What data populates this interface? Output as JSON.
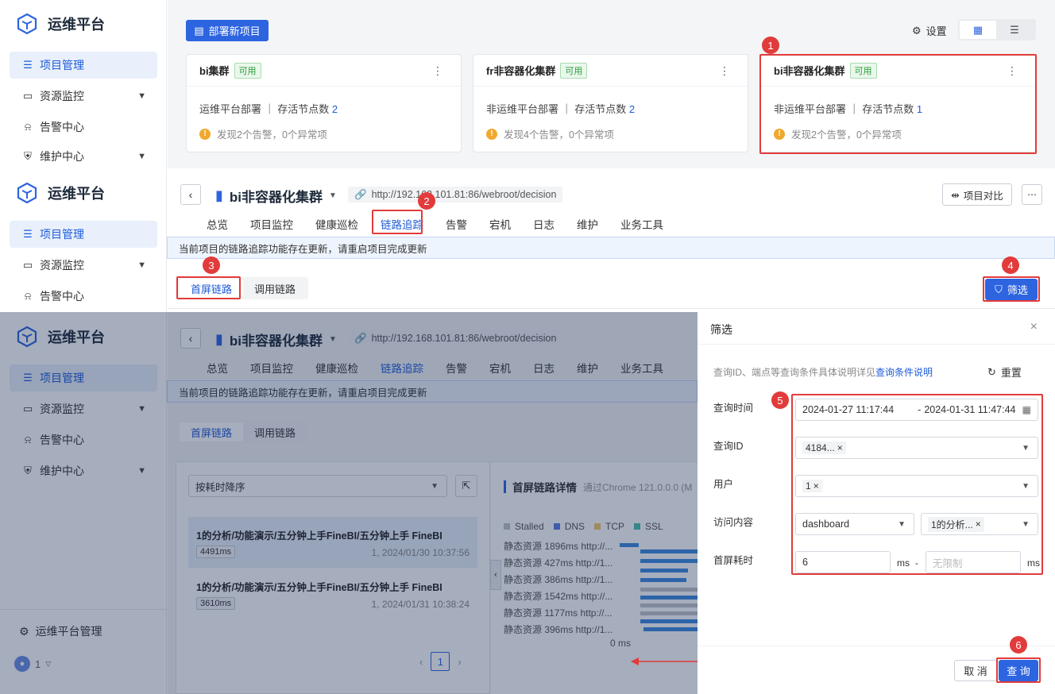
{
  "app": {
    "title": "运维平台"
  },
  "sidebar": {
    "items": [
      {
        "label": "项目管理"
      },
      {
        "label": "资源监控"
      },
      {
        "label": "告警中心"
      },
      {
        "label": "维护中心"
      }
    ],
    "bottom": {
      "platform_manage": "运维平台管理",
      "user": "1"
    }
  },
  "toolbar": {
    "deploy_label": "部署新项目",
    "settings_label": "设置"
  },
  "cards": [
    {
      "name": "bi集群",
      "status": "可用",
      "deploy": "运维平台部署",
      "nodes_label": "存活节点数",
      "nodes": "2",
      "alert": "发现2个告警，0个异常项"
    },
    {
      "name": "fr非容器化集群",
      "status": "可用",
      "deploy": "非运维平台部署",
      "nodes_label": "存活节点数",
      "nodes": "2",
      "alert": "发现4个告警，0个异常项"
    },
    {
      "name": "bi非容器化集群",
      "status": "可用",
      "deploy": "非运维平台部署",
      "nodes_label": "存活节点数",
      "nodes": "1",
      "alert": "发现2个告警，0个异常项"
    }
  ],
  "project": {
    "title": "bi非容器化集群",
    "url": "http://192.168.101.81:86/webroot/decision",
    "compare_label": "项目对比",
    "tabs": [
      "总览",
      "项目监控",
      "健康巡检",
      "链路追踪",
      "告警",
      "宕机",
      "日志",
      "维护",
      "业务工具"
    ],
    "notice": "当前项目的链路追踪功能存在更新，请重启项目完成更新",
    "subtabs": [
      "首屏链路",
      "调用链路"
    ],
    "filter_label": "筛选"
  },
  "trace": {
    "sort_label": "按耗时降序",
    "items": [
      {
        "title": "1的分析/功能演示/五分钟上手FineBI/五分钟上手 FineBI",
        "duration": "4491ms",
        "meta": "1, 2024/01/30 10:37:56"
      },
      {
        "title": "1的分析/功能演示/五分钟上手FineBI/五分钟上手 FineBI",
        "duration": "3610ms",
        "meta": "1, 2024/01/31 10:38:24"
      }
    ],
    "page": "1",
    "detail_title": "首屏链路详情",
    "detail_sub": "通过Chrome 121.0.0.0 (M",
    "legend": [
      "Stalled",
      "DNS",
      "TCP",
      "SSL"
    ],
    "rows": [
      "静态资源 1896ms http://...",
      "静态资源 427ms http://1...",
      "静态资源 386ms http://1...",
      "静态资源 1542ms http://...",
      "静态资源 1177ms http://...",
      "静态资源 396ms http://1..."
    ],
    "axis_zero": "0 ms"
  },
  "drawer": {
    "title": "筛选",
    "hint": "查询ID、端点等查询条件具体说明详见",
    "hint_link": "查询条件说明",
    "reset_label": "重置",
    "fields": {
      "time_label": "查询时间",
      "time_start": "2024-01-27 11:17:44",
      "time_end": "2024-01-31 11:47:44",
      "id_label": "查询ID",
      "id_value": "4184...",
      "user_label": "用户",
      "user_value": "1",
      "content_label": "访问内容",
      "content_type": "dashboard",
      "content_value": "1的分析...",
      "duration_label": "首屏耗时",
      "duration_min": "6",
      "duration_unit": "ms",
      "duration_sep": "-",
      "duration_max_placeholder": "无限制"
    },
    "cancel_label": "取 消",
    "query_label": "查 询"
  },
  "badges": [
    "1",
    "2",
    "3",
    "4",
    "5",
    "6"
  ],
  "colors": {
    "primary": "#2d64e0",
    "annotation": "#e23b3b"
  }
}
